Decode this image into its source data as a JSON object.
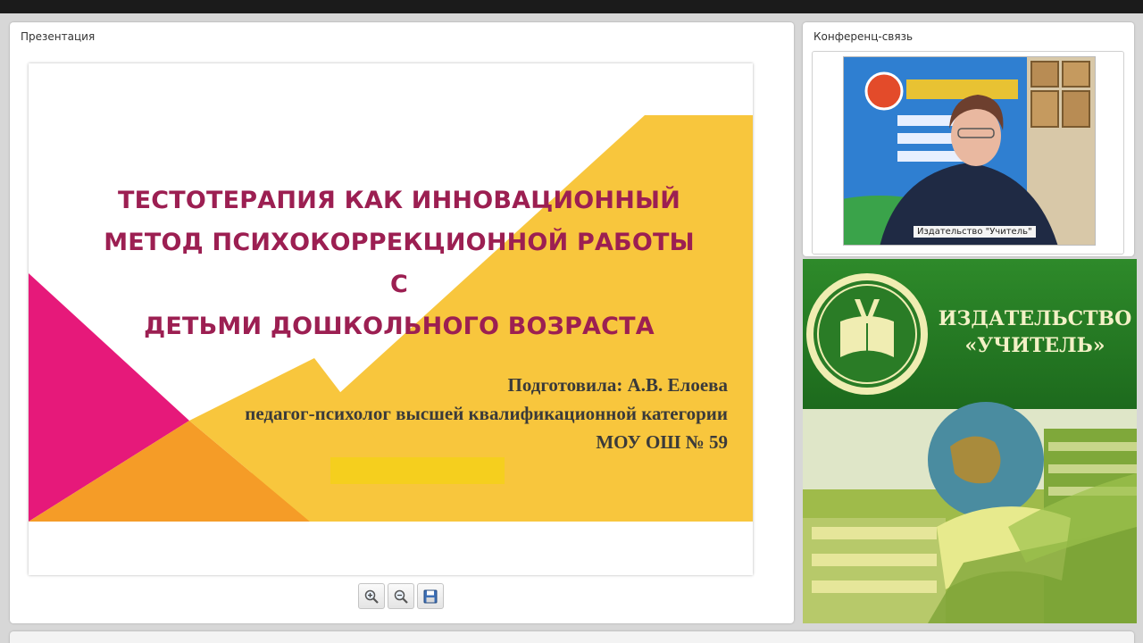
{
  "presentation": {
    "panel_title": "Презентация",
    "slide": {
      "title_lines": [
        "ТЕСТОТЕРАПИЯ КАК ИННОВАЦИОННЫЙ",
        "МЕТОД ПСИХОКОРРЕКЦИОННОЙ РАБОТЫ С",
        "ДЕТЬМИ ДОШКОЛЬНОГО ВОЗРАСТА"
      ],
      "credit_lines": [
        "Подготовила: А.В. Елоева",
        "педагог-психолог высшей квалификационной категории",
        "МОУ ОШ № 59"
      ],
      "colors": {
        "title": "#9c1f52",
        "yellow": "#f8c63d",
        "magenta": "#e6197a",
        "orange": "#f59c27"
      }
    },
    "toolbar": {
      "zoom_in_icon": "zoom-in-icon",
      "zoom_out_icon": "zoom-out-icon",
      "save_icon": "save-icon"
    }
  },
  "conference": {
    "panel_title": "Конференц-связь",
    "video_caption": "Издательство \"Учитель\""
  },
  "banner": {
    "name_lines": [
      "ИЗДАТЕЛЬСТВО",
      "«УЧИТЕЛЬ»"
    ],
    "colors": {
      "green": "#1f6e1f",
      "text": "#f3f1c6"
    }
  }
}
